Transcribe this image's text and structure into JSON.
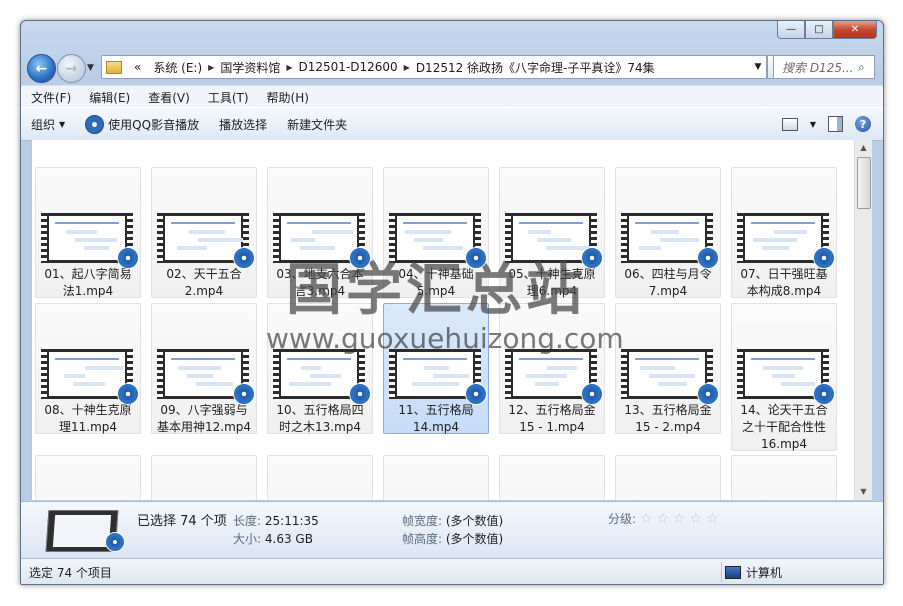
{
  "window": {
    "buttons": {
      "minimize": "—",
      "maximize": "□",
      "close": "✕"
    }
  },
  "nav": {
    "back_icon": "back-arrow-icon",
    "forward_icon": "forward-arrow-icon",
    "breadcrumbs": [
      "«",
      "系统 (E:)",
      "国学资料馆",
      "D12501-D12600",
      "D12512 徐政扬《八字命理-子平真诠》74集"
    ],
    "search_placeholder": "搜索 D125..."
  },
  "menu": [
    "文件(F)",
    "编辑(E)",
    "查看(V)",
    "工具(T)",
    "帮助(H)"
  ],
  "toolbar": {
    "organize": "组织",
    "play_qq": "使用QQ影音播放",
    "play_selection": "播放选择",
    "new_folder": "新建文件夹",
    "help": "?"
  },
  "files": [
    {
      "line1": "01、起八字简易",
      "line2": "法1.mp4"
    },
    {
      "line1": "02、天干五合",
      "line2": "2.mp4"
    },
    {
      "line1": "03、地支六合本",
      "line2": "言3.mp4"
    },
    {
      "line1": "04、十神基础",
      "line2": "5.mp4"
    },
    {
      "line1": "05、十神生克原",
      "line2": "理6.mp4"
    },
    {
      "line1": "06、四柱与月令",
      "line2": "7.mp4"
    },
    {
      "line1": "07、日干强旺基",
      "line2": "本构成8.mp4"
    },
    {
      "line1": "08、十神生克原",
      "line2": "理11.mp4"
    },
    {
      "line1": "09、八字强弱与",
      "line2": "基本用神12.mp4"
    },
    {
      "line1": "10、五行格局四",
      "line2": "时之木13.mp4"
    },
    {
      "line1": "11、五行格局",
      "line2": "14.mp4"
    },
    {
      "line1": "12、五行格局金",
      "line2": "15 - 1.mp4"
    },
    {
      "line1": "13、五行格局金",
      "line2": "15 - 2.mp4"
    },
    {
      "line1": "14、论天干五合",
      "line2": "之十干配合性性",
      "line3": "16.mp4"
    }
  ],
  "details": {
    "selected": "已选择 74 个项",
    "length_label": "长度:",
    "length_value": "25:11:35",
    "size_label": "大小:",
    "size_value": "4.63 GB",
    "width_label": "帧宽度:",
    "width_value": "(多个数值)",
    "height_label": "帧高度:",
    "height_value": "(多个数值)",
    "rating_label": "分级:",
    "rating_stars": "☆☆☆☆☆"
  },
  "status": {
    "left": "选定 74 个项目",
    "right": "计算机"
  },
  "watermark": {
    "main": "国学汇总站",
    "url": "www.guoxuehuizong.com"
  }
}
